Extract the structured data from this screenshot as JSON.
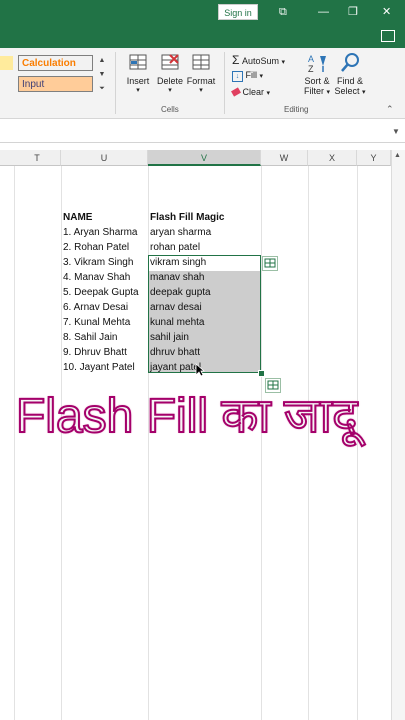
{
  "titlebar": {
    "signin_label": "Sign in"
  },
  "ribbon": {
    "styles": {
      "calculation": "Calculation",
      "input": "Input"
    },
    "cells": {
      "insert": "Insert",
      "delete": "Delete",
      "format": "Format",
      "group": "Cells"
    },
    "editing": {
      "autosum": "AutoSum",
      "fill": "Fill",
      "clear": "Clear",
      "sort": "Sort &",
      "sort2": "Filter",
      "find": "Find &",
      "find2": "Select",
      "group": "Editing"
    }
  },
  "grid": {
    "columns": [
      "T",
      "U",
      "V",
      "W",
      "X",
      "Y"
    ],
    "selected_column": "V",
    "headers": {
      "name": "NAME",
      "magic": "Flash Fill Magic"
    },
    "names": [
      "1. Aryan Sharma",
      "2. Rohan Patel",
      "3. Vikram Singh",
      "4. Manav Shah",
      "5. Deepak Gupta",
      "6. Arnav Desai",
      "7. Kunal Mehta",
      "8. Sahil Jain",
      "9. Dhruv Bhatt",
      "10. Jayant Patel"
    ],
    "flash": [
      "aryan sharma",
      "rohan patel",
      "vikram singh",
      "manav shah",
      "deepak gupta",
      "arnav desai",
      "kunal mehta",
      "sahil jain",
      "dhruv bhatt",
      "jayant patel"
    ]
  },
  "overlay_text": "Flash Fill का जादू",
  "colors": {
    "accent": "#217346",
    "overlay_stroke": "#a4006a"
  }
}
